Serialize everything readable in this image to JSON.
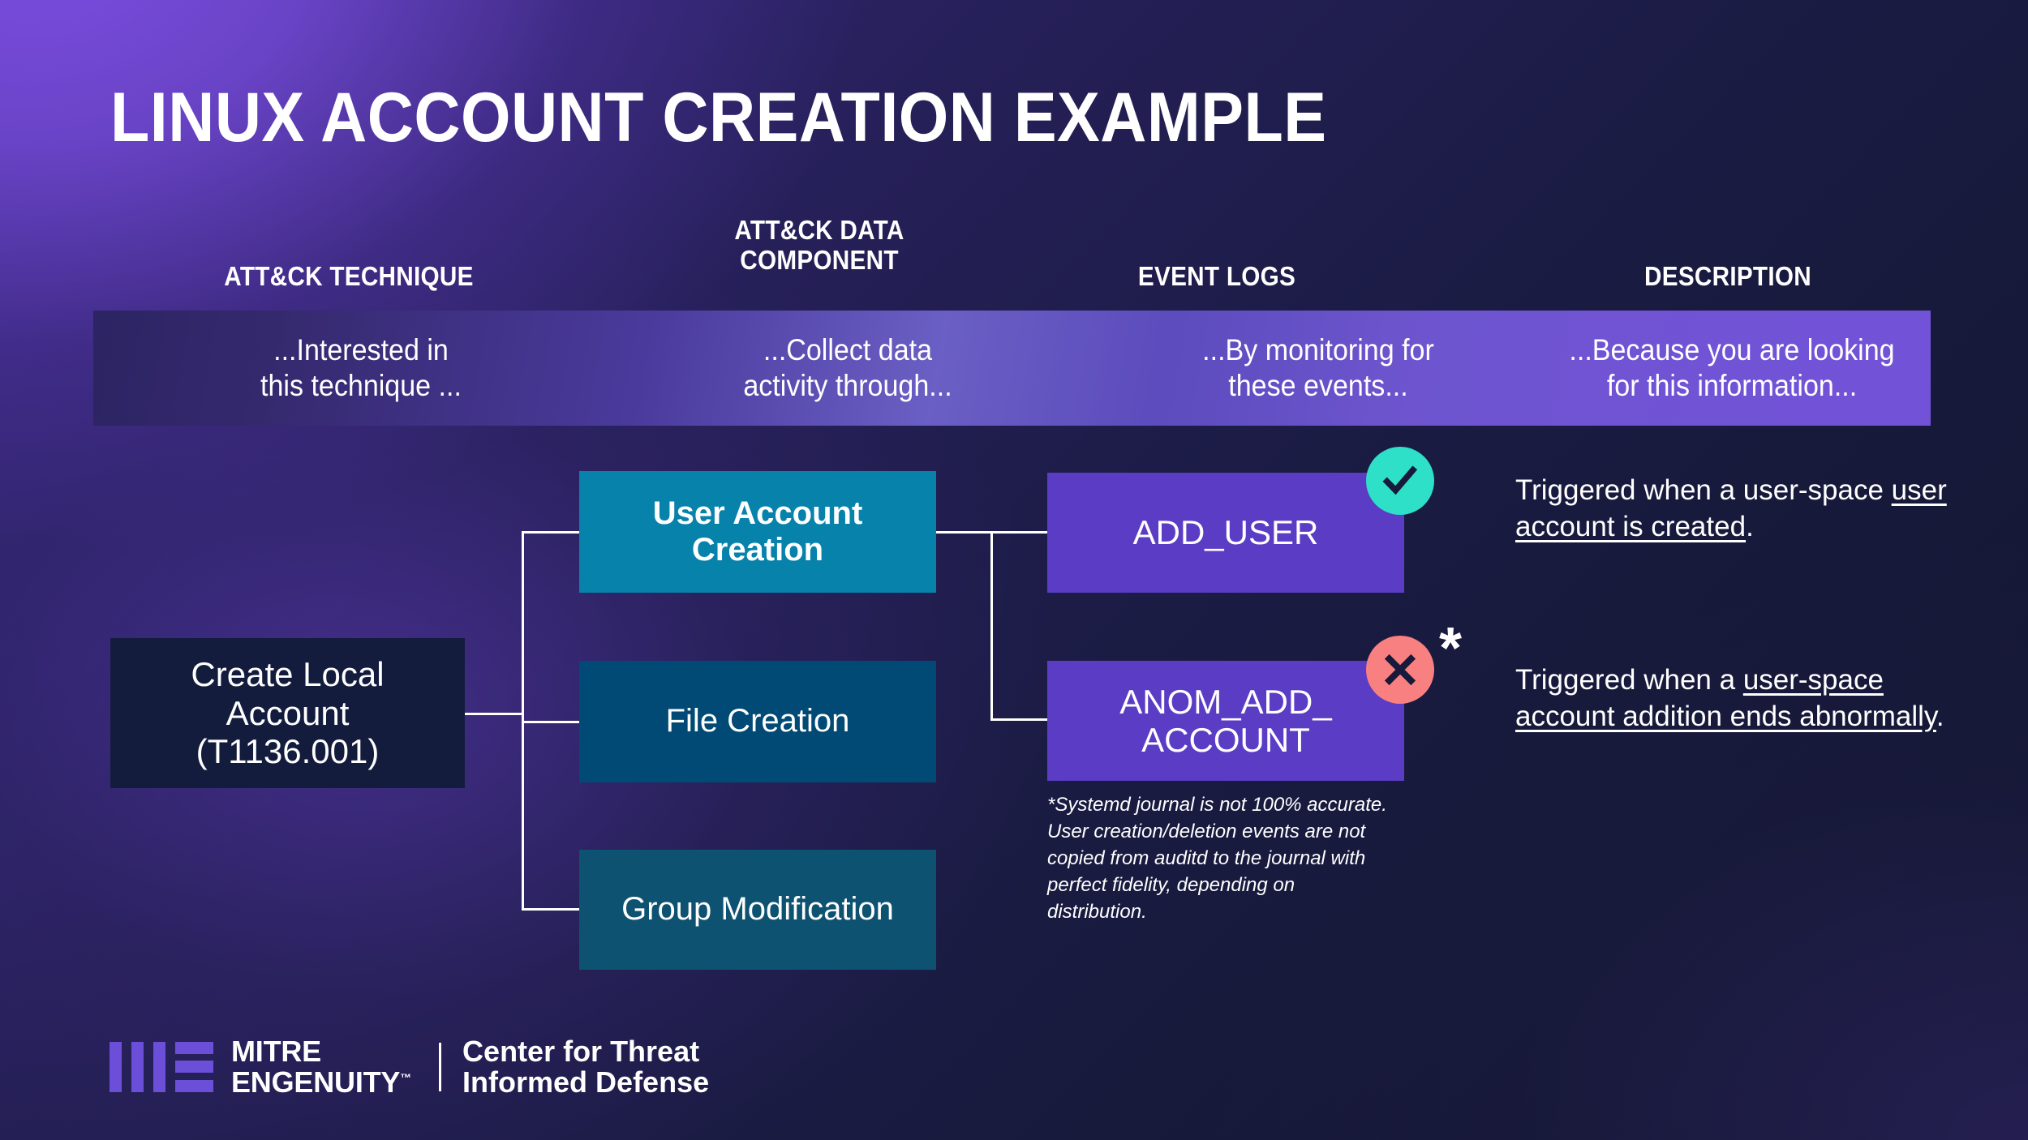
{
  "title": "LINUX ACCOUNT CREATION EXAMPLE",
  "colors": {
    "technique_box": "#141c3e",
    "data_component_primary": "#0682ab",
    "data_component_secondary": "#014a75",
    "event_log_box": "#5b3cc4",
    "badge_success": "#2ee0c8",
    "badge_error": "#f98080",
    "logo_purple": "#6b4fd8"
  },
  "columns": [
    {
      "header": "ATT&CK TECHNIQUE",
      "banner_line1": "...Interested in",
      "banner_line2": "this technique ..."
    },
    {
      "header": "ATT&CK DATA\nCOMPONENT",
      "banner_line1": "...Collect data",
      "banner_line2": "activity through..."
    },
    {
      "header": "EVENT LOGS",
      "banner_line1": "...By monitoring for",
      "banner_line2": "these events..."
    },
    {
      "header": "DESCRIPTION",
      "banner_line1": "...Because you are looking",
      "banner_line2": "for this information..."
    }
  ],
  "column_headers": {
    "technique": "ATT&CK TECHNIQUE",
    "data_component_line1": "ATT&CK DATA",
    "data_component_line2": "COMPONENT",
    "event_logs": "EVENT LOGS",
    "description": "DESCRIPTION"
  },
  "technique": {
    "line1": "Create Local",
    "line2": "Account",
    "line3": "(T1136.001)"
  },
  "data_components": [
    {
      "line1": "User Account",
      "line2": "Creation"
    },
    {
      "line1": "File Creation",
      "line2": ""
    },
    {
      "line1": "Group Modification",
      "line2": ""
    }
  ],
  "event_logs": [
    {
      "line1": "ADD_USER",
      "line2": "",
      "badge": "check-icon"
    },
    {
      "line1": "ANOM_ADD_",
      "line2": "ACCOUNT",
      "badge": "x-icon"
    }
  ],
  "asterisk": "*",
  "footnote": "*Systemd journal is not 100% accurate. User creation/deletion events are not copied from auditd to the journal with perfect fidelity, depending on distribution.",
  "descriptions": [
    {
      "prefix": "Triggered when a user-space ",
      "underlined": "user account is created",
      "suffix": "."
    },
    {
      "prefix": "Triggered when a ",
      "underlined": "user-space account addition ends abnormally",
      "suffix": "."
    }
  ],
  "logo": {
    "brand_line1": "MITRE",
    "brand_line2": "ENGENUITY",
    "trademark": "™",
    "partner_line1": "Center for Threat",
    "partner_line2": "Informed Defense"
  }
}
